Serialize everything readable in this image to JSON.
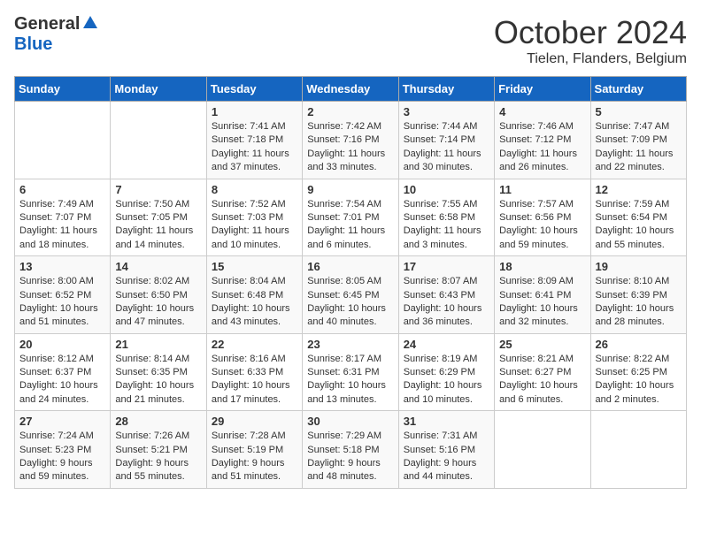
{
  "header": {
    "logo_general": "General",
    "logo_blue": "Blue",
    "month_title": "October 2024",
    "location": "Tielen, Flanders, Belgium"
  },
  "days_of_week": [
    "Sunday",
    "Monday",
    "Tuesday",
    "Wednesday",
    "Thursday",
    "Friday",
    "Saturday"
  ],
  "weeks": [
    [
      {
        "day": "",
        "content": ""
      },
      {
        "day": "",
        "content": ""
      },
      {
        "day": "1",
        "content": "Sunrise: 7:41 AM\nSunset: 7:18 PM\nDaylight: 11 hours\nand 37 minutes."
      },
      {
        "day": "2",
        "content": "Sunrise: 7:42 AM\nSunset: 7:16 PM\nDaylight: 11 hours\nand 33 minutes."
      },
      {
        "day": "3",
        "content": "Sunrise: 7:44 AM\nSunset: 7:14 PM\nDaylight: 11 hours\nand 30 minutes."
      },
      {
        "day": "4",
        "content": "Sunrise: 7:46 AM\nSunset: 7:12 PM\nDaylight: 11 hours\nand 26 minutes."
      },
      {
        "day": "5",
        "content": "Sunrise: 7:47 AM\nSunset: 7:09 PM\nDaylight: 11 hours\nand 22 minutes."
      }
    ],
    [
      {
        "day": "6",
        "content": "Sunrise: 7:49 AM\nSunset: 7:07 PM\nDaylight: 11 hours\nand 18 minutes."
      },
      {
        "day": "7",
        "content": "Sunrise: 7:50 AM\nSunset: 7:05 PM\nDaylight: 11 hours\nand 14 minutes."
      },
      {
        "day": "8",
        "content": "Sunrise: 7:52 AM\nSunset: 7:03 PM\nDaylight: 11 hours\nand 10 minutes."
      },
      {
        "day": "9",
        "content": "Sunrise: 7:54 AM\nSunset: 7:01 PM\nDaylight: 11 hours\nand 6 minutes."
      },
      {
        "day": "10",
        "content": "Sunrise: 7:55 AM\nSunset: 6:58 PM\nDaylight: 11 hours\nand 3 minutes."
      },
      {
        "day": "11",
        "content": "Sunrise: 7:57 AM\nSunset: 6:56 PM\nDaylight: 10 hours\nand 59 minutes."
      },
      {
        "day": "12",
        "content": "Sunrise: 7:59 AM\nSunset: 6:54 PM\nDaylight: 10 hours\nand 55 minutes."
      }
    ],
    [
      {
        "day": "13",
        "content": "Sunrise: 8:00 AM\nSunset: 6:52 PM\nDaylight: 10 hours\nand 51 minutes."
      },
      {
        "day": "14",
        "content": "Sunrise: 8:02 AM\nSunset: 6:50 PM\nDaylight: 10 hours\nand 47 minutes."
      },
      {
        "day": "15",
        "content": "Sunrise: 8:04 AM\nSunset: 6:48 PM\nDaylight: 10 hours\nand 43 minutes."
      },
      {
        "day": "16",
        "content": "Sunrise: 8:05 AM\nSunset: 6:45 PM\nDaylight: 10 hours\nand 40 minutes."
      },
      {
        "day": "17",
        "content": "Sunrise: 8:07 AM\nSunset: 6:43 PM\nDaylight: 10 hours\nand 36 minutes."
      },
      {
        "day": "18",
        "content": "Sunrise: 8:09 AM\nSunset: 6:41 PM\nDaylight: 10 hours\nand 32 minutes."
      },
      {
        "day": "19",
        "content": "Sunrise: 8:10 AM\nSunset: 6:39 PM\nDaylight: 10 hours\nand 28 minutes."
      }
    ],
    [
      {
        "day": "20",
        "content": "Sunrise: 8:12 AM\nSunset: 6:37 PM\nDaylight: 10 hours\nand 24 minutes."
      },
      {
        "day": "21",
        "content": "Sunrise: 8:14 AM\nSunset: 6:35 PM\nDaylight: 10 hours\nand 21 minutes."
      },
      {
        "day": "22",
        "content": "Sunrise: 8:16 AM\nSunset: 6:33 PM\nDaylight: 10 hours\nand 17 minutes."
      },
      {
        "day": "23",
        "content": "Sunrise: 8:17 AM\nSunset: 6:31 PM\nDaylight: 10 hours\nand 13 minutes."
      },
      {
        "day": "24",
        "content": "Sunrise: 8:19 AM\nSunset: 6:29 PM\nDaylight: 10 hours\nand 10 minutes."
      },
      {
        "day": "25",
        "content": "Sunrise: 8:21 AM\nSunset: 6:27 PM\nDaylight: 10 hours\nand 6 minutes."
      },
      {
        "day": "26",
        "content": "Sunrise: 8:22 AM\nSunset: 6:25 PM\nDaylight: 10 hours\nand 2 minutes."
      }
    ],
    [
      {
        "day": "27",
        "content": "Sunrise: 7:24 AM\nSunset: 5:23 PM\nDaylight: 9 hours\nand 59 minutes."
      },
      {
        "day": "28",
        "content": "Sunrise: 7:26 AM\nSunset: 5:21 PM\nDaylight: 9 hours\nand 55 minutes."
      },
      {
        "day": "29",
        "content": "Sunrise: 7:28 AM\nSunset: 5:19 PM\nDaylight: 9 hours\nand 51 minutes."
      },
      {
        "day": "30",
        "content": "Sunrise: 7:29 AM\nSunset: 5:18 PM\nDaylight: 9 hours\nand 48 minutes."
      },
      {
        "day": "31",
        "content": "Sunrise: 7:31 AM\nSunset: 5:16 PM\nDaylight: 9 hours\nand 44 minutes."
      },
      {
        "day": "",
        "content": ""
      },
      {
        "day": "",
        "content": ""
      }
    ]
  ]
}
